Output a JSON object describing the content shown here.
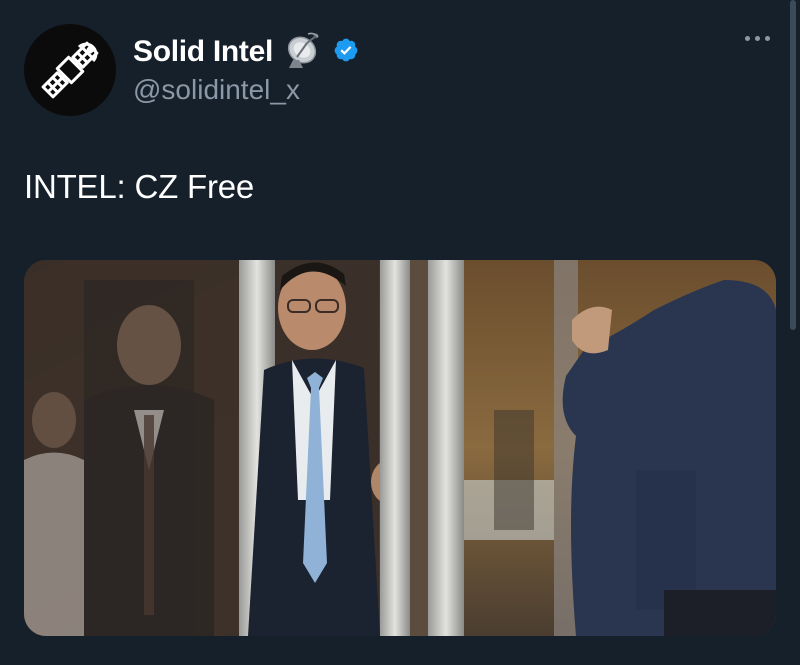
{
  "tweet": {
    "display_name": "Solid Intel",
    "name_emoji": "📡",
    "handle": "@solidintel_x",
    "text": "INTEL: CZ Free",
    "verified_icon": "verified-badge-icon",
    "avatar_icon": "satellite-icon",
    "more_icon": "more-options-icon"
  },
  "media": {
    "description_icon": "photo"
  },
  "colors": {
    "background": "#15202b",
    "secondary_text": "#8b98a5",
    "verified": "#1d9bf0"
  }
}
